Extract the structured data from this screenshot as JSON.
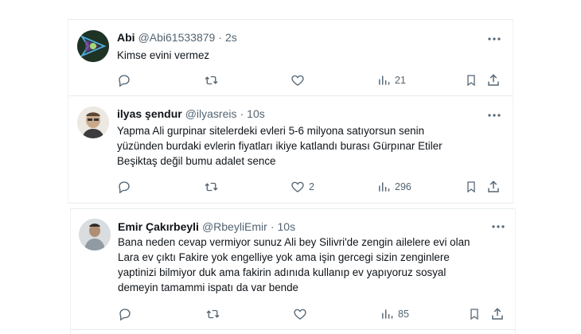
{
  "colors": {
    "text": "#0f1419",
    "muted": "#536471",
    "border": "#eff3f4"
  },
  "tweets": [
    {
      "name": "Abi",
      "handle": "@Abi61533879",
      "dot": "·",
      "time": "2s",
      "lines": [
        "Kimse evini vermez"
      ],
      "reply_count": "",
      "retweet_count": "",
      "like_count": "",
      "view_count": "21"
    },
    {
      "name": "ilyas şendur",
      "handle": "@ilyasreis",
      "dot": "·",
      "time": "10s",
      "lines": [
        "Yapma Ali gurpinar sitelerdeki evleri 5-6 milyona satıyorsun senin",
        "yüzünden burdaki evlerin fiyatları ikiye katlandı burası Gürpınar Etiler",
        "Beşiktaş değil bumu adalet sence"
      ],
      "reply_count": "",
      "retweet_count": "",
      "like_count": "2",
      "view_count": "296"
    },
    {
      "name": "Emir Çakırbeyli",
      "handle": "@RbeyliEmir",
      "dot": "·",
      "time": "10s",
      "lines": [
        "Bana neden cevap vermiyor sunuz Ali bey Silivri'de zengin ailelere evi olan",
        "Lara ev çıktı Fakire yok engelliye yok ama işin gercegi sizin zenginlere",
        "yaptinizi bilmiyor duk ama fakirin adınıda kullanıp ev yapıyoruz sosyal",
        "demeyin tamammi ispatı da var bende"
      ],
      "reply_count": "",
      "retweet_count": "",
      "like_count": "",
      "view_count": "85"
    }
  ]
}
